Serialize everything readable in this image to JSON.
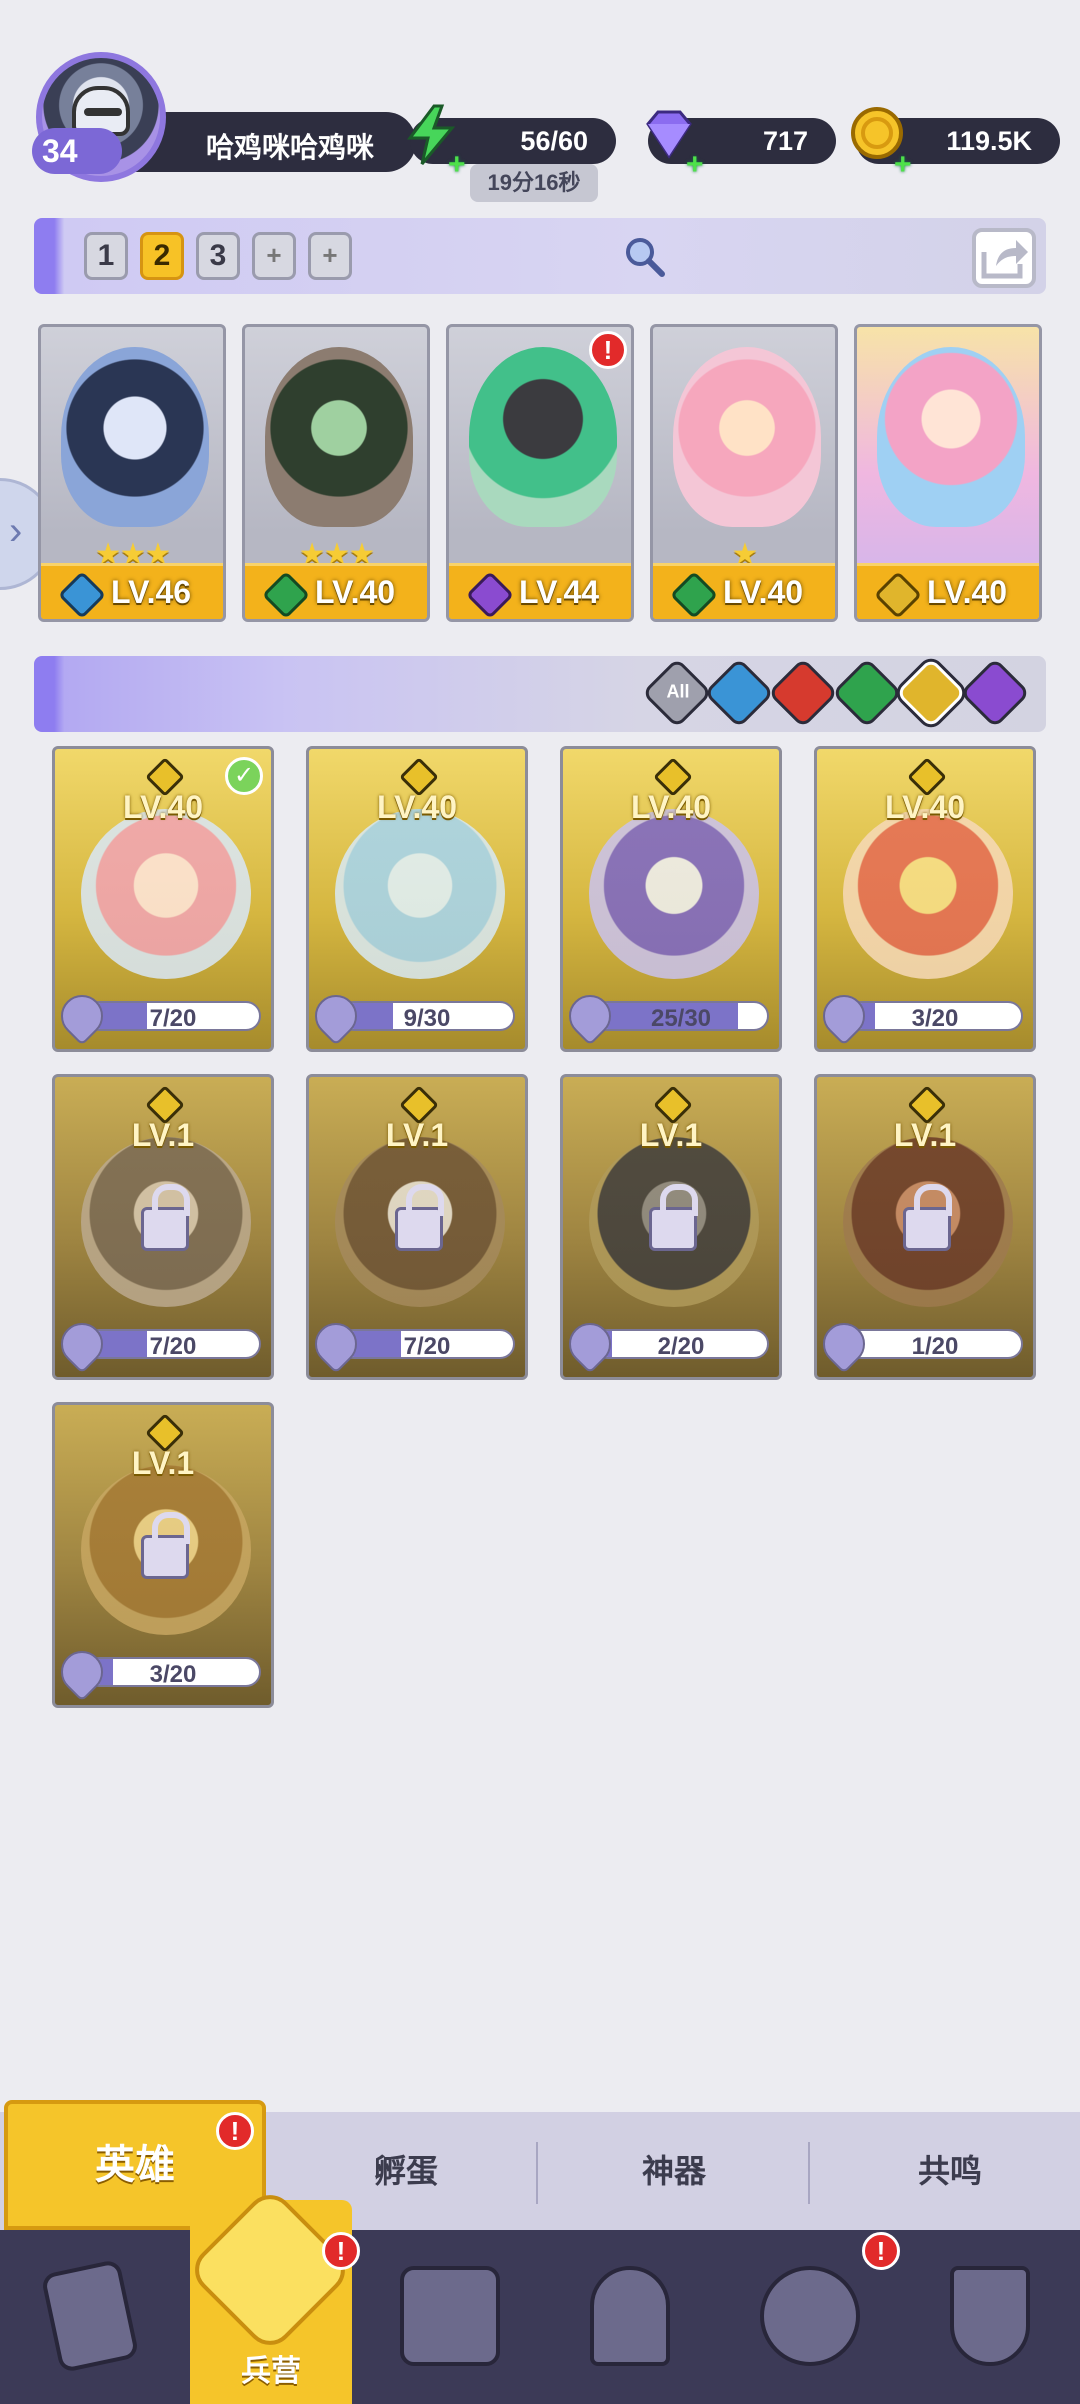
{
  "player": {
    "level": "34",
    "name": "哈鸡咪哈鸡咪"
  },
  "resources": {
    "energy": "56/60",
    "energy_timer": "19分16秒",
    "gems": "717",
    "gold": "119.5K"
  },
  "team": {
    "slots": [
      "1",
      "2",
      "3",
      "+",
      "+"
    ],
    "active_slot": "2",
    "heroes": [
      {
        "level": "LV.46",
        "stars": "★★★",
        "element": "water",
        "color": "#3a94d6"
      },
      {
        "level": "LV.40",
        "stars": "★★★",
        "element": "wind",
        "color": "#2fa34d"
      },
      {
        "level": "LV.44",
        "stars": "",
        "element": "dark",
        "color": "#8a4bd0",
        "alert": "!"
      },
      {
        "level": "LV.40",
        "stars": "★",
        "element": "wind",
        "color": "#2fa34d"
      },
      {
        "level": "LV.40",
        "stars": "",
        "element": "light",
        "color": "#e0b52c"
      }
    ]
  },
  "filters": {
    "all": "All",
    "selected": "light"
  },
  "heroes": [
    {
      "level": "LV.40",
      "progress": "7/20",
      "fraction": 0.35,
      "locked": false,
      "selected": true
    },
    {
      "level": "LV.40",
      "progress": "9/30",
      "fraction": 0.3,
      "locked": false
    },
    {
      "level": "LV.40",
      "progress": "25/30",
      "fraction": 0.83,
      "locked": false
    },
    {
      "level": "LV.40",
      "progress": "3/20",
      "fraction": 0.15,
      "locked": false
    },
    {
      "level": "LV.1",
      "progress": "7/20",
      "fraction": 0.35,
      "locked": true
    },
    {
      "level": "LV.1",
      "progress": "7/20",
      "fraction": 0.35,
      "locked": true
    },
    {
      "level": "LV.1",
      "progress": "2/20",
      "fraction": 0.1,
      "locked": true
    },
    {
      "level": "LV.1",
      "progress": "1/20",
      "fraction": 0.05,
      "locked": true
    },
    {
      "level": "LV.1",
      "progress": "3/20",
      "fraction": 0.15,
      "locked": true
    }
  ],
  "subtabs": {
    "hero": "英雄",
    "hatch": "孵蛋",
    "artifact": "神器",
    "resonance": "共鸣"
  },
  "alerts": {
    "hero_tab": "!",
    "barracks": "!",
    "summon": "!"
  },
  "navbar": {
    "barracks": "兵营"
  },
  "colors": {
    "accent": "#f5c52a",
    "bar": "#2d2d3f",
    "nav": "#3c3a57"
  }
}
